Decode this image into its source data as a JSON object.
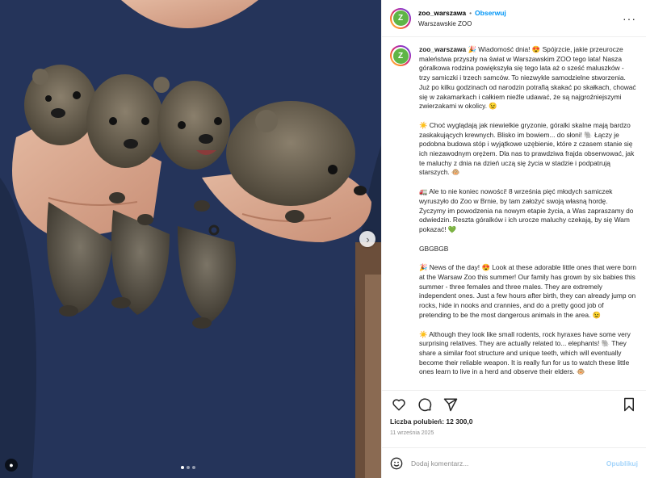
{
  "post": {
    "username": "zoo_warszawa",
    "separator": "•",
    "follow_label": "Obserwuj",
    "location": "Warszawskie ZOO",
    "more_label": "···",
    "avatar_glyph": "Z"
  },
  "caption": {
    "username": "zoo_warszawa",
    "paragraphs": [
      "🎉 Wiadomość dnia! 😍 Spójrzcie, jakie przeurocze maleństwa przyszły na świat w Warszawskim ZOO tego lata! Nasza góralkowa rodzina powiększyła się tego lata aż o sześć maluszków - trzy samiczki i trzech samców. To niezwykle samodzielne stworzenia. Już po kilku godzinach od narodzin potrafią skakać po skałkach, chować się w zakamarkach i całkiem nieźle udawać, że są najgroźniejszymi zwierzakami w okolicy. 😉",
      "☀️ Choć wyglądają jak niewielkie gryzonie, góralki skalne mają bardzo zaskakujących krewnych. Blisko im bowiem... do słoni! 🐘 Łączy je podobna budowa stóp i wyjątkowe uzębienie, które z czasem stanie się ich niezawodnym orężem. Dla nas to prawdziwa frajda obserwować, jak te maluchy z dnia na dzień uczą się życia w stadzie i podpatrują starszych. 🐵",
      "🚛 Ale to nie koniec nowości! 8 września pięć młodych samiczek wyruszyło do Zoo w Brnie, by tam założyć swoją własną hordę. Życzymy im powodzenia na nowym etapie życia, a Was zapraszamy do odwiedzin. Reszta góralków i ich urocze maluchy czekają, by się Wam pokazać! 💚",
      "GBGBGB",
      "🎉 News of the day! 😍 Look at these adorable little ones that were born at the Warsaw Zoo this summer! Our family has grown by six babies this summer - three females and three males. They are extremely independent ones. Just a few hours after birth, they can already jump on rocks, hide in nooks and crannies, and do a pretty good job of pretending to be the most dangerous animals in the area. 😉",
      "☀️ Although they look like small rodents, rock hyraxes have some very surprising relatives. They are actually related to... elephants! 🐘 They share a similar foot structure and unique teeth, which will eventually become their reliable weapon. It is really fun for us to watch these little ones learn to live in a herd and observe their elders. 🐵"
    ]
  },
  "stats": {
    "likes": "Liczba polubień: 12 300,0",
    "date": "11 września 2025"
  },
  "comment": {
    "placeholder": "Dodaj komentarz...",
    "publish_label": "Opublikuj"
  },
  "carousel": {
    "count": 3,
    "active": 0
  },
  "colors": {
    "accent": "#0095f6",
    "shirt": "#233152",
    "brand_green": "#5fb546"
  }
}
